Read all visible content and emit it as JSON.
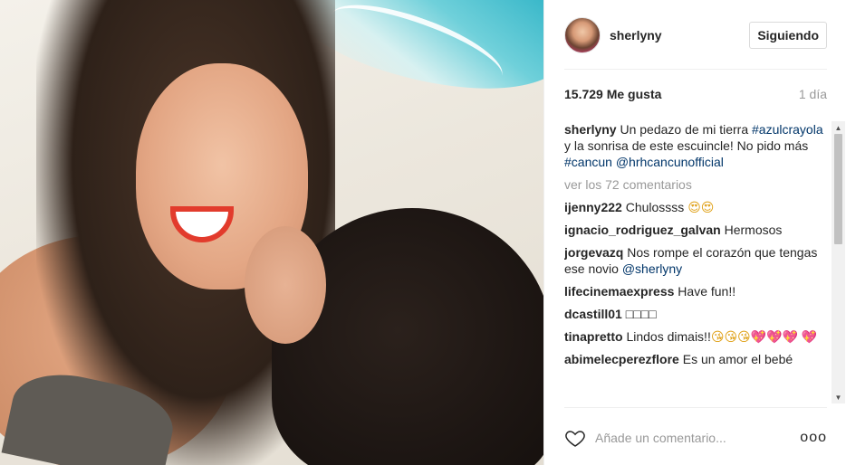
{
  "post": {
    "username": "sherlyny",
    "follow_label": "Siguiendo",
    "likes": "15.729 Me gusta",
    "age": "1 día"
  },
  "caption": {
    "user": "sherlyny",
    "text1": "Un pedazo de mi tierra",
    "hashtag1": "#azulcrayola",
    "text2": "y la sonrisa de este escuincle! No pido más",
    "hashtag2": "#cancun",
    "mention": "@hrhcancunofficial"
  },
  "view_all": "ver los 72 comentarios",
  "comments": [
    {
      "user": "ijenny222",
      "text": "Chulossss",
      "emoji": "😍😍"
    },
    {
      "user": "ignacio_rodriguez_galvan",
      "text": "Hermosos"
    },
    {
      "user": "jorgevazq",
      "text": "Nos rompe el corazón que tengas ese novio",
      "mention": "@sherlyny"
    },
    {
      "user": "lifecinemaexpress",
      "text": "Have fun!!"
    },
    {
      "user": "dcastill01",
      "text": "□□□□"
    },
    {
      "user": "tinapretto",
      "text": "Lindos dimais!!",
      "emoji": "😘😘😘",
      "hearts": "💖💖💖 💖"
    },
    {
      "user": "abimelecperezflore",
      "text": "Es un amor el bebé"
    }
  ],
  "footer": {
    "placeholder": "Añade un comentario...",
    "more": "ooo"
  },
  "colors": {
    "link": "#003569",
    "muted": "#999999",
    "border": "#efefef"
  },
  "icons": {
    "like": "heart-outline-icon",
    "more": "more-options-icon"
  }
}
